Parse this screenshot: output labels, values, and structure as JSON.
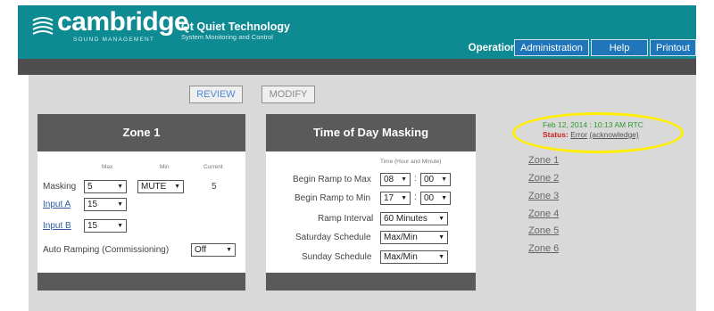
{
  "header": {
    "brand": "cambridge",
    "brand_sub": "SOUND MANAGEMENT",
    "product_title": "Qt Quiet Technology",
    "product_sub": "System Monitoring and Control",
    "nav": {
      "active": "Operations",
      "administration": "Administration",
      "help": "Help",
      "printout": "Printout"
    }
  },
  "toolbar": {
    "review": "REVIEW",
    "modify": "MODIFY"
  },
  "zone_panel": {
    "title": "Zone 1",
    "col_max": "Max",
    "col_min": "Min",
    "col_current": "Current",
    "masking_label": "Masking",
    "masking_max": "5",
    "masking_min": "MUTE",
    "masking_current": "5",
    "input_a_label": "Input A",
    "input_a_value": "15",
    "input_b_label": "Input B",
    "input_b_value": "15",
    "auto_ramp_label": "Auto Ramping (Commissioning)",
    "auto_ramp_value": "Off"
  },
  "tod_panel": {
    "title": "Time of Day Masking",
    "time_header": "Time (Hour and Minute)",
    "begin_ramp_max_label": "Begin Ramp to Max",
    "begin_ramp_max_hour": "08",
    "begin_ramp_max_minute": "00",
    "begin_ramp_min_label": "Begin Ramp to Min",
    "begin_ramp_min_hour": "17",
    "begin_ramp_min_minute": "00",
    "ramp_interval_label": "Ramp Interval",
    "ramp_interval_value": "60 Minutes",
    "saturday_label": "Saturday Schedule",
    "saturday_value": "Max/Min",
    "sunday_label": "Sunday Schedule",
    "sunday_value": "Max/Min",
    "colon": ":"
  },
  "status": {
    "datetime": "Feb 12, 2014 : 10:13 AM RTC",
    "label": "Status:",
    "value": "Error",
    "ack": "(acknowledge)"
  },
  "zones": [
    "Zone 1",
    "Zone 2",
    "Zone 3",
    "Zone 4",
    "Zone 5",
    "Zone 6"
  ],
  "colors": {
    "header": "#0e8a93",
    "nav_button": "#1f76b8",
    "panel_head": "#5a5a5a",
    "status_date": "#2f9a2f",
    "status_label": "#cc2222",
    "highlight": "#ffee00"
  }
}
